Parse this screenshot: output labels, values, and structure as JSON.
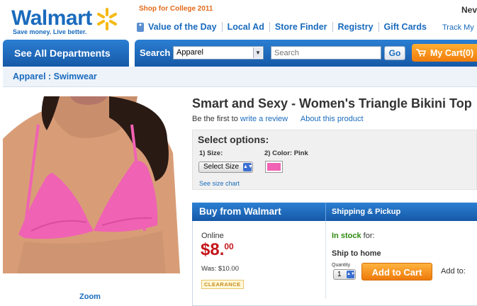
{
  "header": {
    "logo_text": "Walmart",
    "tagline": "Save money. Live better.",
    "promo": "Shop for College 2011",
    "new_tag": "Nev",
    "nav": [
      "Value of the Day",
      "Local Ad",
      "Store Finder",
      "Registry",
      "Gift Cards"
    ],
    "track": "Track My"
  },
  "navbar": {
    "departments": "See All Departments",
    "search_label": "Search",
    "category": "Apparel",
    "search_placeholder": "Search",
    "go": "Go",
    "cart": "My Cart(0)"
  },
  "breadcrumb": {
    "text": "Apparel : Swimwear"
  },
  "product": {
    "title": "Smart and Sexy - Women's Triangle Bikini Top",
    "review_prefix": "Be the first to",
    "review_link": "write a review",
    "about_link": "About this product",
    "zoom": "Zoom"
  },
  "options": {
    "title": "Select options:",
    "size_label": "1) Size:",
    "color_label": "2) Color: Pink",
    "size_select": "Select Size",
    "size_chart": "See size chart",
    "color_hex": "#f062b4"
  },
  "buy": {
    "header": "Buy from Walmart",
    "shipping_tab": "Shipping & Pickup",
    "online": "Online",
    "price_dollars": "$8.",
    "price_cents": "00",
    "was": "Was: $10.00",
    "clearance": "CLEARANCE",
    "instock_bold": "In stock",
    "instock_rest": "for:",
    "ship_to_home": "Ship to home",
    "qty_label": "Quantity",
    "qty_value": "1",
    "add_to_cart": "Add to Cart",
    "add_to": "Add to:"
  },
  "colors": {
    "brand_blue": "#1a6bbd",
    "accent_orange": "#f07c0b",
    "price_red": "#c4161c",
    "swatch_pink": "#f062b4"
  }
}
